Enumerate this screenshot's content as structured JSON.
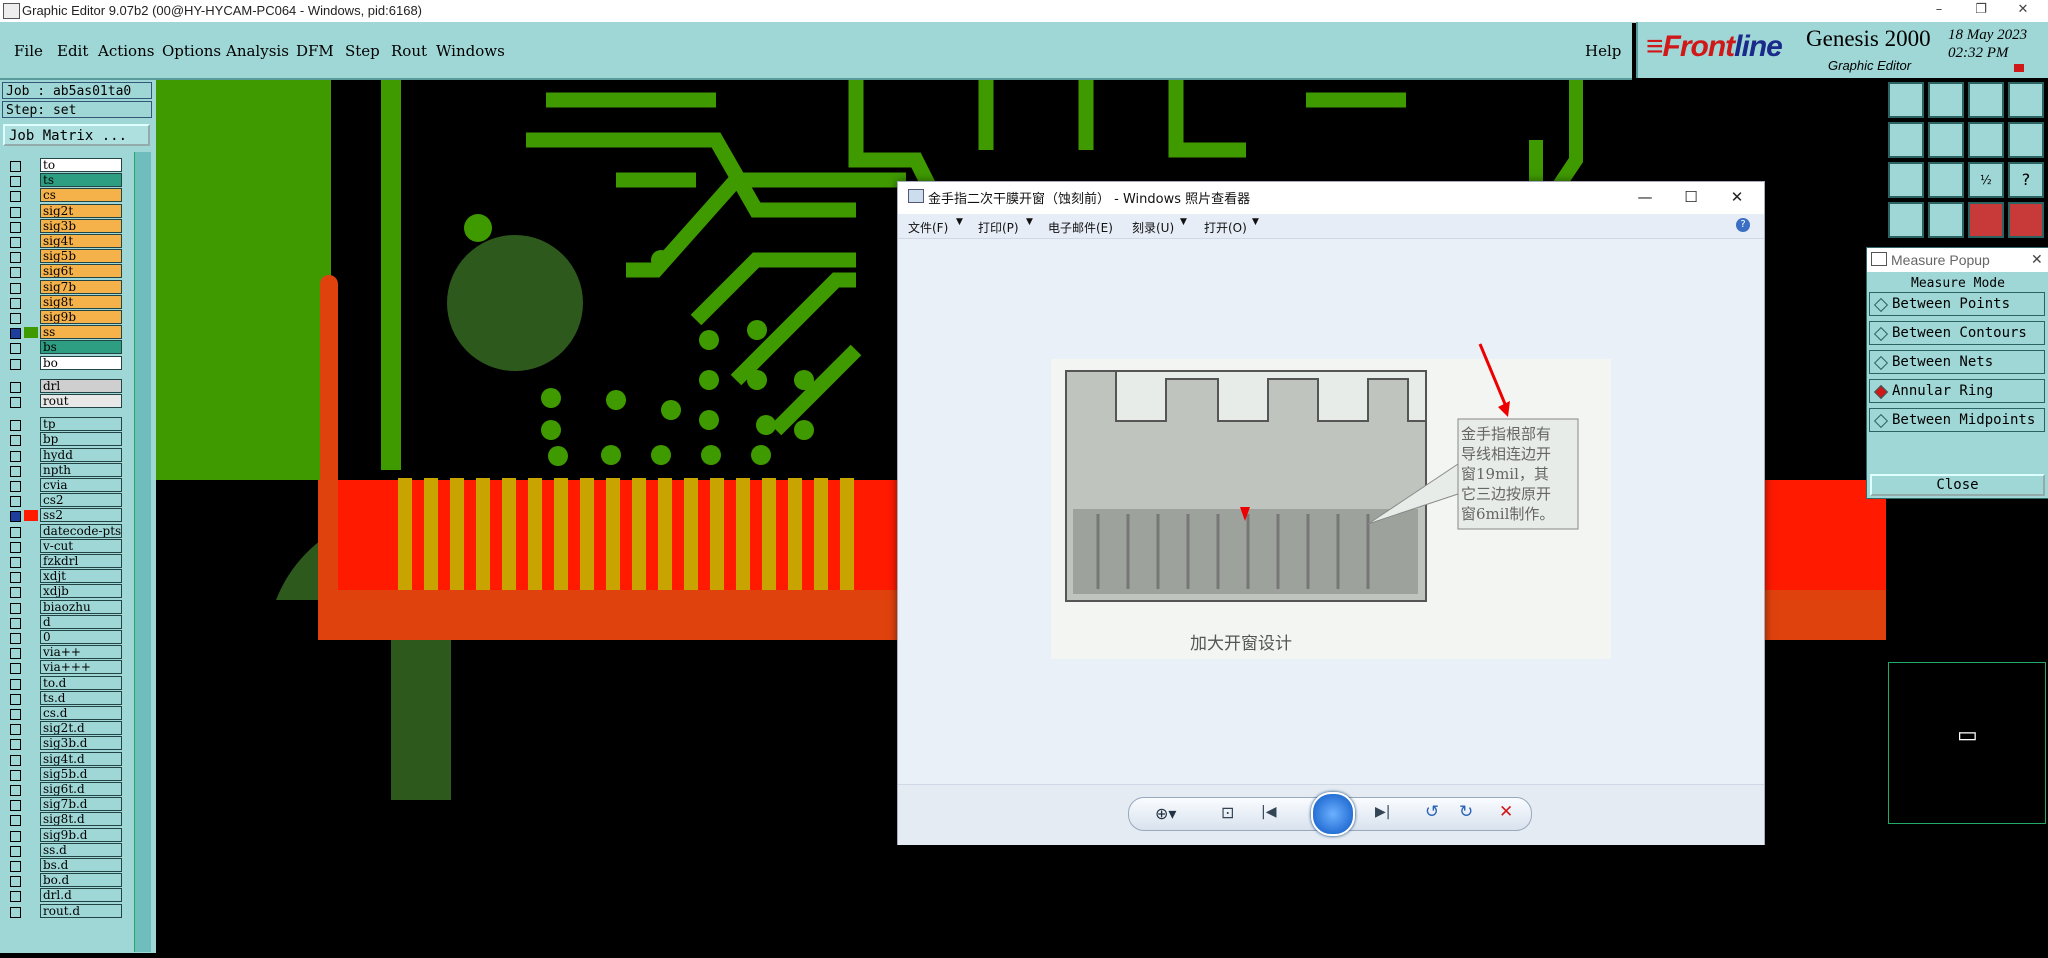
{
  "window": {
    "title": "Graphic Editor 9.07b2 (00@HY-HYCAM-PC064 - Windows, pid:6168)",
    "min": "–",
    "restore": "❐",
    "close": "✕"
  },
  "menu": [
    "File",
    "Edit",
    "Actions",
    "Options",
    "Analysis",
    "DFM",
    "Step",
    "Rout",
    "Windows"
  ],
  "help": "Help",
  "brand": {
    "logo_first": "≡Front",
    "logo_second": "line",
    "product": "Genesis 2000",
    "subtitle": "Graphic Editor",
    "date": "18 May 2023",
    "time": "02:32 PM"
  },
  "job": {
    "job_line": "Job : ab5as01ta0",
    "step_line": "Step: set",
    "matrix_button": "Job Matrix ..."
  },
  "layers": [
    {
      "name": "to",
      "color": "#ffffff",
      "active": false
    },
    {
      "name": "ts",
      "color": "#2e9e82",
      "active": false
    },
    {
      "name": "cs",
      "color": "#f6b24a",
      "active": false
    },
    {
      "name": "sig2t",
      "color": "#f6b24a",
      "active": false
    },
    {
      "name": "sig3b",
      "color": "#f6b24a",
      "active": false
    },
    {
      "name": "sig4t",
      "color": "#f6b24a",
      "active": false
    },
    {
      "name": "sig5b",
      "color": "#f6b24a",
      "active": false
    },
    {
      "name": "sig6t",
      "color": "#f6b24a",
      "active": false
    },
    {
      "name": "sig7b",
      "color": "#f6b24a",
      "active": false
    },
    {
      "name": "sig8t",
      "color": "#f6b24a",
      "active": false
    },
    {
      "name": "sig9b",
      "color": "#f6b24a",
      "active": false
    },
    {
      "name": "ss",
      "color": "#f6b24a",
      "active": true
    },
    {
      "name": "bs",
      "color": "#2e9e82",
      "active": false
    },
    {
      "name": "bo",
      "color": "#ffffff",
      "active": false
    },
    {
      "name": "drl",
      "color": "#cfcfcf",
      "active": false
    },
    {
      "name": "rout",
      "color": "#e8e8e8",
      "active": false
    },
    {
      "name": "tp",
      "color": "#9fd6d6",
      "active": false
    },
    {
      "name": "bp",
      "color": "#9fd6d6",
      "active": false
    },
    {
      "name": "hydd",
      "color": "#9fd6d6",
      "active": false
    },
    {
      "name": "npth",
      "color": "#9fd6d6",
      "active": false
    },
    {
      "name": "cvia",
      "color": "#9fd6d6",
      "active": false
    },
    {
      "name": "cs2",
      "color": "#9fd6d6",
      "active": false
    },
    {
      "name": "ss2",
      "color": "#9fd6d6",
      "active": true
    },
    {
      "name": "datecode-pts",
      "color": "#9fd6d6",
      "active": false
    },
    {
      "name": "v-cut",
      "color": "#9fd6d6",
      "active": false
    },
    {
      "name": "fzkdrl",
      "color": "#9fd6d6",
      "active": false
    },
    {
      "name": "xdjt",
      "color": "#9fd6d6",
      "active": false
    },
    {
      "name": "xdjb",
      "color": "#9fd6d6",
      "active": false
    },
    {
      "name": "biaozhu",
      "color": "#9fd6d6",
      "active": false
    },
    {
      "name": "d",
      "color": "#9fd6d6",
      "active": false
    },
    {
      "name": "0",
      "color": "#9fd6d6",
      "active": false
    },
    {
      "name": "via++",
      "color": "#9fd6d6",
      "active": false
    },
    {
      "name": "via+++",
      "color": "#9fd6d6",
      "active": false
    },
    {
      "name": "to.d",
      "color": "#9fd6d6",
      "active": false
    },
    {
      "name": "ts.d",
      "color": "#9fd6d6",
      "active": false
    },
    {
      "name": "cs.d",
      "color": "#9fd6d6",
      "active": false
    },
    {
      "name": "sig2t.d",
      "color": "#9fd6d6",
      "active": false
    },
    {
      "name": "sig3b.d",
      "color": "#9fd6d6",
      "active": false
    },
    {
      "name": "sig4t.d",
      "color": "#9fd6d6",
      "active": false
    },
    {
      "name": "sig5b.d",
      "color": "#9fd6d6",
      "active": false
    },
    {
      "name": "sig6t.d",
      "color": "#9fd6d6",
      "active": false
    },
    {
      "name": "sig7b.d",
      "color": "#9fd6d6",
      "active": false
    },
    {
      "name": "sig8t.d",
      "color": "#9fd6d6",
      "active": false
    },
    {
      "name": "sig9b.d",
      "color": "#9fd6d6",
      "active": false
    },
    {
      "name": "ss.d",
      "color": "#9fd6d6",
      "active": false
    },
    {
      "name": "bs.d",
      "color": "#9fd6d6",
      "active": false
    },
    {
      "name": "bo.d",
      "color": "#9fd6d6",
      "active": false
    },
    {
      "name": "drl.d",
      "color": "#9fd6d6",
      "active": false
    },
    {
      "name": "rout.d",
      "color": "#9fd6d6",
      "active": false
    }
  ],
  "viewer": {
    "title": "金手指二次干膜开窗（蚀刻前） - Windows 照片查看器",
    "menu": [
      "文件(F)",
      "打印(P)",
      "电子邮件(E)",
      "刻录(U)",
      "打开(O)"
    ],
    "annotation": [
      "金手指根部有",
      "导线相连边开",
      "窗19mil，其",
      "它三边按原开",
      "窗6mil制作。"
    ],
    "caption": "加大开窗设计"
  },
  "measure": {
    "title": "Measure Popup",
    "mode_label": "Measure Mode",
    "options": [
      "Between Points",
      "Between Contours",
      "Between Nets",
      "Annular Ring",
      "Between Midpoints"
    ],
    "selected": "Annular Ring",
    "close_label": "Close"
  },
  "colors": {
    "panel": "#9fd6d6",
    "copper": "#3f9a00",
    "finger": "#c9a300",
    "mask": "#ff1a00"
  }
}
